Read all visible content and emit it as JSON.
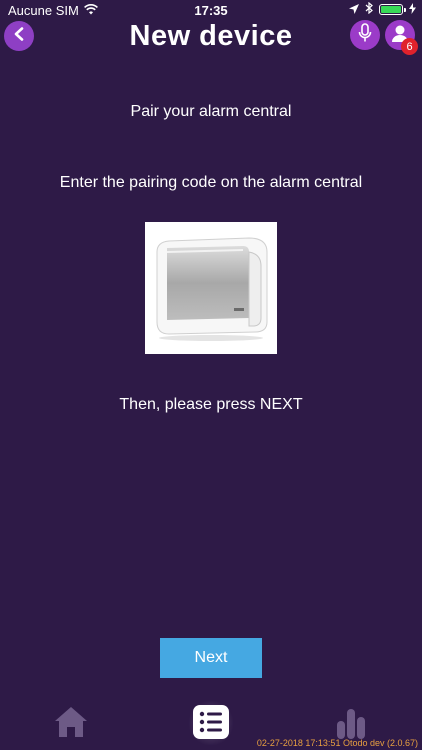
{
  "status": {
    "carrier": "Aucune SIM",
    "time": "17:35"
  },
  "header": {
    "title": "New device",
    "badge_count": "6"
  },
  "content": {
    "line1": "Pair your alarm central",
    "line2": "Enter the pairing code on the alarm central",
    "line3": "Then, please press NEXT"
  },
  "actions": {
    "next_label": "Next"
  },
  "tabs": [
    {
      "icon": "home-icon",
      "active": false
    },
    {
      "icon": "list-icon",
      "active": true
    },
    {
      "icon": "stats-icon",
      "active": false
    }
  ],
  "footer": {
    "version": "02-27-2018 17:13:51 Otodo dev (2.0.67)"
  },
  "colors": {
    "background": "#2e1a47",
    "accent_purple": "#9b3bc8",
    "button_blue": "#45a8e2",
    "badge_red": "#e0222c",
    "battery_green": "#38d957",
    "version_text": "#e8a040"
  }
}
